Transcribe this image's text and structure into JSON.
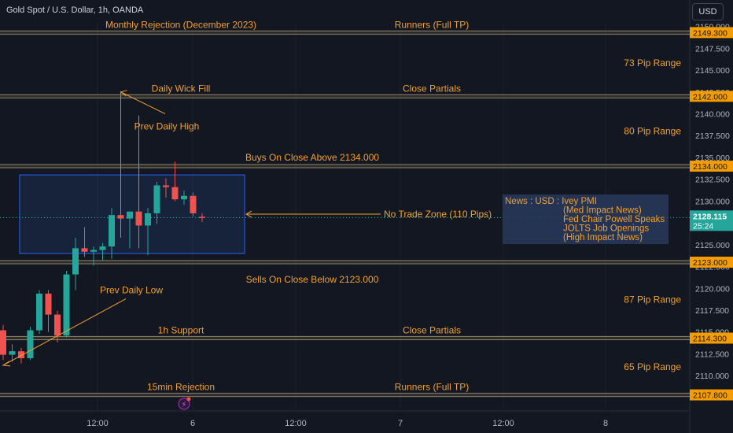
{
  "header": {
    "title": "Gold Spot / U.S. Dollar, 1h, OANDA",
    "currency": "USD"
  },
  "colors": {
    "background": "#131722",
    "grid": "#1e222d",
    "up": "#26a69a",
    "down": "#ef5350",
    "level_line": "#8a7b5c",
    "annotation": "#f0a030",
    "zone_fill": "#1e3a66",
    "zone_stroke": "#2962ff",
    "price_tag": "#f59d00",
    "news_box": "#2a3a5c"
  },
  "chart_data": {
    "type": "candlestick",
    "symbol": "XAUUSD",
    "timeframe": "1h",
    "y_axis": {
      "range": [
        2106.5,
        2151.5
      ],
      "ticks": [
        2150.0,
        2147.5,
        2145.0,
        2142.5,
        2140.0,
        2137.5,
        2135.0,
        2132.5,
        2130.0,
        2127.5,
        2125.0,
        2122.5,
        2120.0,
        2117.5,
        2115.0,
        2112.5,
        2110.0
      ]
    },
    "x_axis": {
      "ticks": [
        "12:00",
        "6",
        "12:00",
        "7",
        "12:00",
        "8"
      ]
    },
    "candles": [
      {
        "o": 2115.2,
        "h": 2115.8,
        "l": 2111.8,
        "c": 2112.4
      },
      {
        "o": 2112.4,
        "h": 2113.6,
        "l": 2111.6,
        "c": 2112.8
      },
      {
        "o": 2112.8,
        "h": 2113.2,
        "l": 2111.4,
        "c": 2112.0
      },
      {
        "o": 2112.0,
        "h": 2115.6,
        "l": 2111.8,
        "c": 2115.2
      },
      {
        "o": 2115.2,
        "h": 2119.8,
        "l": 2114.8,
        "c": 2119.4
      },
      {
        "o": 2119.4,
        "h": 2119.8,
        "l": 2115.0,
        "c": 2117.0
      },
      {
        "o": 2117.0,
        "h": 2117.4,
        "l": 2113.8,
        "c": 2114.6
      },
      {
        "o": 2114.6,
        "h": 2122.0,
        "l": 2114.4,
        "c": 2121.6
      },
      {
        "o": 2121.6,
        "h": 2125.8,
        "l": 2119.8,
        "c": 2124.6
      },
      {
        "o": 2124.6,
        "h": 2127.0,
        "l": 2123.6,
        "c": 2124.2
      },
      {
        "o": 2124.2,
        "h": 2124.8,
        "l": 2122.6,
        "c": 2124.4
      },
      {
        "o": 2124.4,
        "h": 2125.2,
        "l": 2123.2,
        "c": 2124.8
      },
      {
        "o": 2124.8,
        "h": 2129.2,
        "l": 2123.4,
        "c": 2128.4
      },
      {
        "o": 2128.4,
        "h": 2142.5,
        "l": 2125.8,
        "c": 2128.0
      },
      {
        "o": 2128.0,
        "h": 2128.8,
        "l": 2124.6,
        "c": 2128.8
      },
      {
        "o": 2128.8,
        "h": 2139.8,
        "l": 2124.6,
        "c": 2127.2
      },
      {
        "o": 2127.2,
        "h": 2129.2,
        "l": 2123.8,
        "c": 2128.6
      },
      {
        "o": 2128.6,
        "h": 2132.2,
        "l": 2127.4,
        "c": 2131.8
      },
      {
        "o": 2131.8,
        "h": 2132.6,
        "l": 2130.4,
        "c": 2131.6
      },
      {
        "o": 2131.6,
        "h": 2134.5,
        "l": 2130.0,
        "c": 2130.2
      },
      {
        "o": 2130.2,
        "h": 2131.2,
        "l": 2129.6,
        "c": 2130.6
      },
      {
        "o": 2130.6,
        "h": 2131.0,
        "l": 2128.2,
        "c": 2128.6
      },
      {
        "o": 2128.2,
        "h": 2128.6,
        "l": 2127.6,
        "c": 2128.1
      }
    ],
    "current_price": {
      "value": "2128.115",
      "countdown": "25:24"
    },
    "levels": [
      {
        "price": 2149.3,
        "label": "2149.300",
        "left_text": "Monthly Rejection (December 2023)",
        "right_text": "Runners (Full TP)"
      },
      {
        "price": 2142.0,
        "label": "2142.000",
        "left_text": "Daily Wick Fill",
        "right_text": "Close Partials"
      },
      {
        "price": 2134.0,
        "label": "2134.000",
        "left_text": "",
        "right_text": ""
      },
      {
        "price": 2123.0,
        "label": "2123.000",
        "left_text": "",
        "right_text": ""
      },
      {
        "price": 2114.3,
        "label": "2114.300",
        "left_text": "1h Support",
        "right_text": "Close Partials"
      },
      {
        "price": 2107.8,
        "label": "2107.800",
        "left_text": "15min Rejection",
        "right_text": "Runners (Full TP)"
      }
    ],
    "annotations": {
      "buys": "Buys On Close Above 2134.000",
      "sells": "Sells On Close Below 2123.000",
      "no_trade": "No Trade Zone (110 Pips)",
      "prev_high": "Prev Daily High",
      "prev_low": "Prev Daily Low",
      "range_73": "73 Pip Range",
      "range_80": "80 Pip Range",
      "range_87": "87 Pip Range",
      "range_65": "65 Pip Range"
    },
    "news": [
      "News : USD : Ivey PMI",
      "(Med Impact News)",
      "Fed Chair Powell Speaks",
      "JOLTS Job Openings",
      "(High Impact News)"
    ],
    "zone": {
      "top": 2133.0,
      "bottom": 2124.0
    }
  }
}
